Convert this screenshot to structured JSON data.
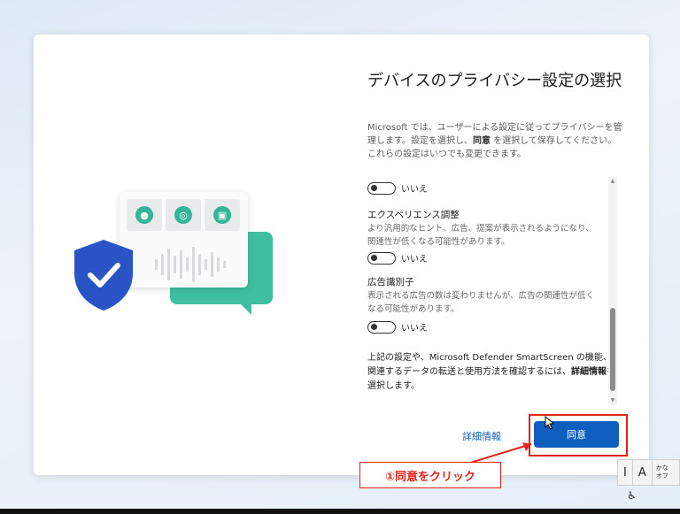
{
  "dialog": {
    "title": "デバイスのプライバシー設定の選択",
    "description_pre": "Microsoft では、ユーザーによる設定に従ってプライバシーを管理します。設定を選択し、",
    "description_bold": "同意",
    "description_post": " を選択して保存してください。これらの設定はいつでも変更できます。"
  },
  "settings": {
    "top_toggle_label": "いいえ",
    "experience_title": "エクスペリエンス調整",
    "experience_desc": "より汎用的なヒント、広告、提案が表示されるようになり、関連性が低くなる可能性があります。",
    "experience_toggle_label": "いいえ",
    "ad_id_title": "広告識別子",
    "ad_id_desc": "表示される広告の数は変わりませんが、広告の関連性が低くなる可能性があります。",
    "ad_id_toggle_label": "いいえ",
    "footer_pre": "上記の設定や、Microsoft Defender SmartScreen の機能、関連するデータの転送と使用方法を確認するには、",
    "footer_bold": "詳細情報",
    "footer_post": "を選択します。"
  },
  "actions": {
    "more_info_label": "詳細情報",
    "agree_label": "同意"
  },
  "annotation": {
    "callout_text": "①同意をクリック",
    "accent_color": "#e2231a"
  },
  "ime": {
    "mode_i": "I",
    "mode_a": "A",
    "kana_line1": "かな",
    "kana_line2": "オフ"
  },
  "colors": {
    "primary_button": "#0f5fbf",
    "link": "#1a5fb4",
    "illustration_teal": "#3fbfa0",
    "shield_blue": "#2a54c6"
  },
  "icons": {
    "illustration_tiles": [
      "location-pin-icon",
      "fingerprint-icon",
      "lock-icon"
    ],
    "shield": "shield-check-icon",
    "accessibility": "accessibility-icon"
  }
}
